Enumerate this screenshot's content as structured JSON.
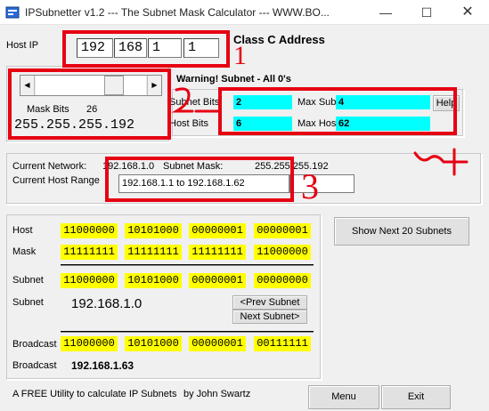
{
  "window": {
    "title": "IPSubnetter v1.2     --- The Subnet Mask Calculator ---      WWW.BO...",
    "min_label": "—",
    "max_label": "☐",
    "close_label": "✕"
  },
  "host_ip": {
    "label": "Host IP",
    "octets": [
      "192",
      "168",
      "1",
      "1"
    ],
    "class_label": "Class C Address"
  },
  "mask": {
    "mask_bits_label": "Mask Bits",
    "mask_bits_value": "26",
    "mask_value": "255.255.255.192",
    "slider_level_fraction": 0.75
  },
  "warning": "Warning!  Subnet - All 0's",
  "bits": {
    "subnet_bits_label": "Subnet Bits",
    "subnet_bits_value": "2",
    "host_bits_label": "Host Bits",
    "host_bits_value": "6",
    "max_subnets_label": "Max Subnets",
    "max_subnets_value": "4",
    "max_hosts_label": "Max Hosts",
    "max_hosts_value": "62",
    "help_label": "Help"
  },
  "current": {
    "network_label": "Current Network:",
    "network_value": "192.168.1.0",
    "subnet_mask_label": "Subnet Mask:",
    "subnet_mask_value": "255.255.255.192",
    "host_range_label": "Current Host Range",
    "host_range_value": "192.168.1.1 to 192.168.1.62",
    "extra_value": ""
  },
  "binary": {
    "host_label": "Host",
    "host_bits": [
      "11000000",
      "10101000",
      "00000001",
      "00000001"
    ],
    "mask_label": "Mask",
    "mask_bits": [
      "11111111",
      "11111111",
      "11111111",
      "11000000"
    ],
    "subnet_label": "Subnet",
    "subnet_bits": [
      "11000000",
      "10101000",
      "00000001",
      "00000000"
    ],
    "subnet_dec_label": "Subnet",
    "subnet_dec_value": "192.168.1.0",
    "broadcast_label": "Broadcast",
    "broadcast_bits": [
      "11000000",
      "10101000",
      "00000001",
      "00111111"
    ],
    "broadcast_dec_label": "Broadcast",
    "broadcast_dec_value": "192.168.1.63"
  },
  "buttons": {
    "show_next": "Show Next 20 Subnets",
    "prev_subnet": "<Prev Subnet",
    "next_subnet": "Next Subnet>",
    "menu": "Menu",
    "exit": "Exit"
  },
  "footer": {
    "text": "A FREE Utility to calculate IP Subnets",
    "author": "by John Swartz"
  },
  "annotations": {
    "note_1": "1",
    "note_3": "3",
    "note_4": "4",
    "annotation_color": "#e60012"
  },
  "colors": {
    "binary_highlight": "#ffff00",
    "value_highlight": "#00ffff",
    "annotation": "#e60012"
  }
}
